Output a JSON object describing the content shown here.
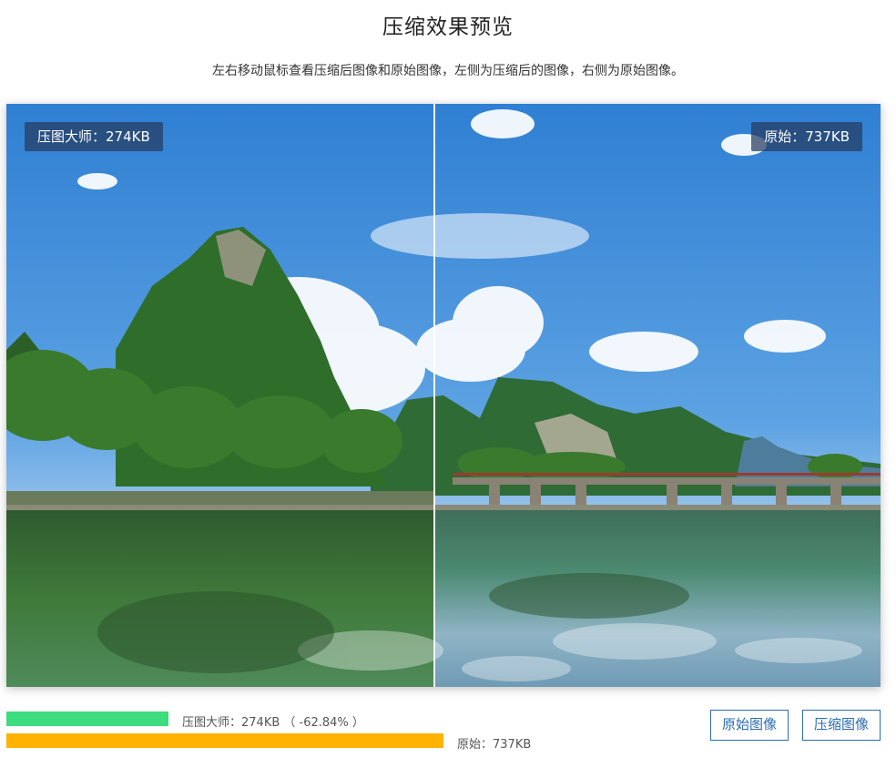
{
  "header": {
    "title": "压缩效果预览",
    "subtitle": "左右移动鼠标查看压缩后图像和原始图像，左侧为压缩后的图像，右侧为原始图像。"
  },
  "preview": {
    "compressed_tag": "压图大师：274KB",
    "original_tag": "原始：737KB",
    "divider_position_fraction": 0.49
  },
  "stats": {
    "compressed_label": "压图大师：274KB （ -62.84% ）",
    "original_label": "原始：737KB",
    "compressed_ratio": 0.3716,
    "compressed_color": "#3ddc7e",
    "original_color": "#ffb300"
  },
  "actions": {
    "original_button": "原始图像",
    "compressed_button": "压缩图像",
    "accent_color": "#2b6cb3"
  }
}
